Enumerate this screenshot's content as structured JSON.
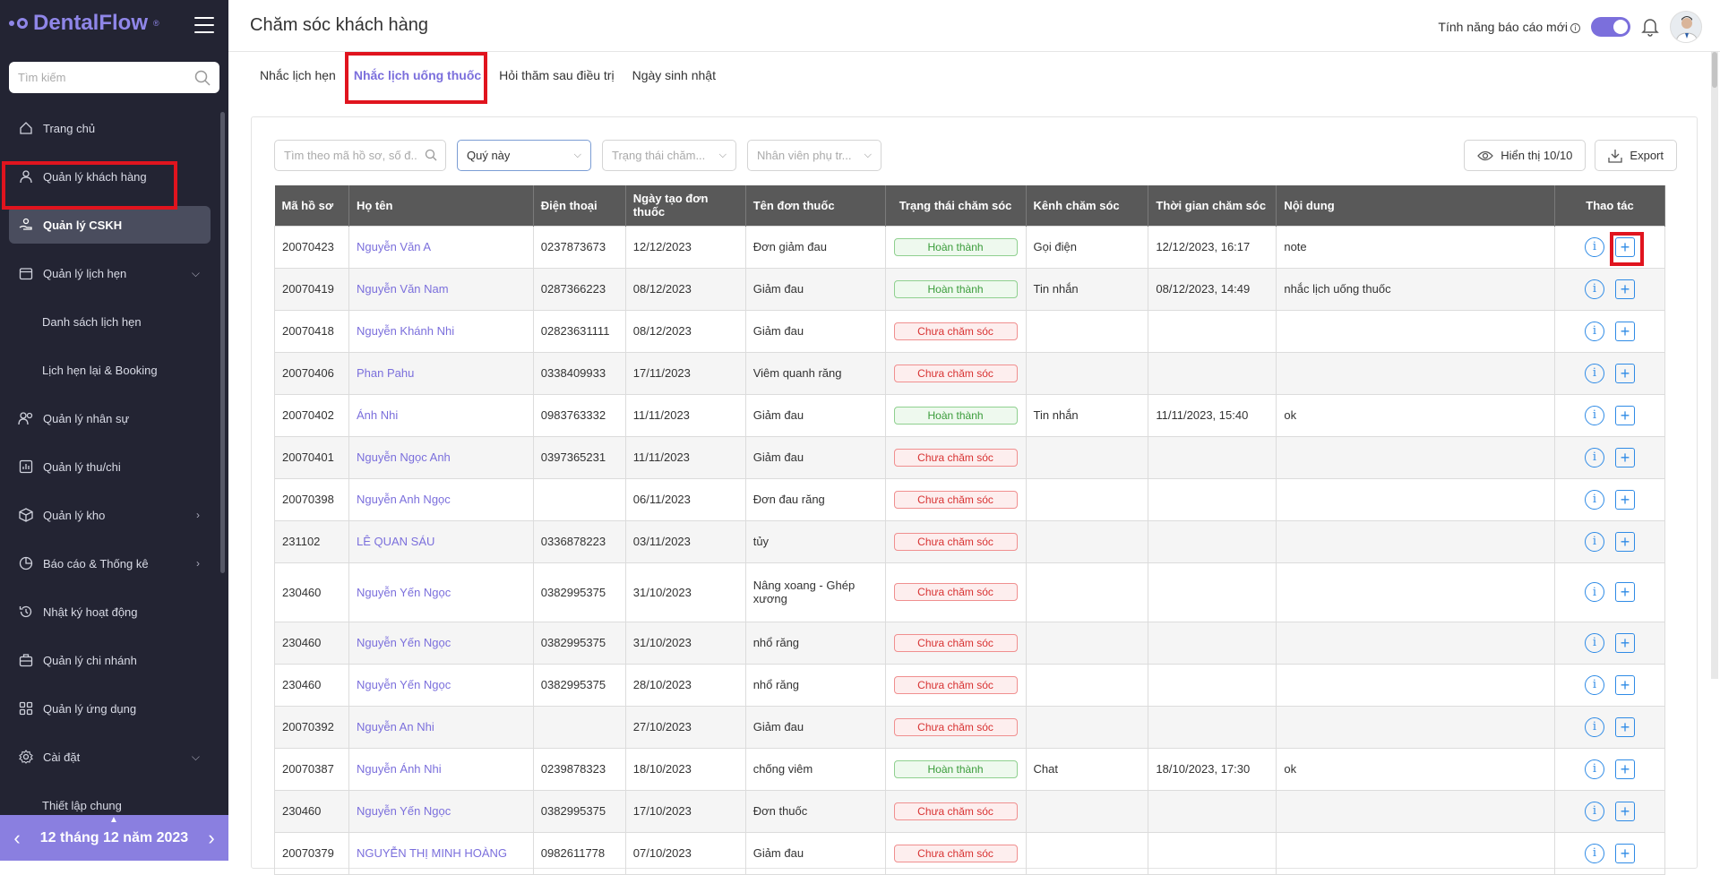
{
  "sidebar": {
    "logo": "DentalFlow",
    "search_placeholder": "Tìm kiếm",
    "items": [
      {
        "label": "Trang chủ",
        "icon": "home-icon"
      },
      {
        "label": "Quản lý khách hàng",
        "icon": "user-icon"
      },
      {
        "label": "Quản lý CSKH",
        "icon": "care-icon",
        "active": true
      },
      {
        "label": "Quản lý lịch hẹn",
        "icon": "calendar-icon",
        "chevron": "down"
      },
      {
        "label": "Danh sách lịch hẹn",
        "sub": true
      },
      {
        "label": "Lịch hẹn lại & Booking",
        "sub": true
      },
      {
        "label": "Quản lý nhân sự",
        "icon": "users-icon"
      },
      {
        "label": "Quản lý thu/chi",
        "icon": "chart-icon"
      },
      {
        "label": "Quản lý kho",
        "icon": "box-icon",
        "chevron": "right"
      },
      {
        "label": "Báo cáo & Thống kê",
        "icon": "pie-icon",
        "chevron": "right"
      },
      {
        "label": "Nhật ký hoạt động",
        "icon": "history-icon"
      },
      {
        "label": "Quản lý chi nhánh",
        "icon": "briefcase-icon"
      },
      {
        "label": "Quản lý ứng dụng",
        "icon": "apps-icon"
      },
      {
        "label": "Cài đặt",
        "icon": "settings-icon",
        "chevron": "down"
      },
      {
        "label": "Thiết lập chung",
        "sub": true
      }
    ],
    "date": "12 tháng 12 năm 2023"
  },
  "header": {
    "title": "Chăm sóc khách hàng",
    "feature_label": "Tính năng báo cáo mới"
  },
  "tabs": [
    {
      "label": "Nhắc lịch hẹn"
    },
    {
      "label": "Nhắc lịch uống thuốc",
      "active": true
    },
    {
      "label": "Hỏi thăm sau điều trị"
    },
    {
      "label": "Ngày sinh nhật"
    }
  ],
  "filters": {
    "search_placeholder": "Tìm theo mã hồ sơ, số đ...",
    "period": "Quý này",
    "status_placeholder": "Trạng thái chăm...",
    "staff_placeholder": "Nhân viên phụ tr..."
  },
  "actions": {
    "display": "Hiển thị 10/10",
    "export": "Export"
  },
  "table": {
    "headers": [
      "Mã hồ sơ",
      "Họ tên",
      "Điện thoại",
      "Ngày tạo đơn thuốc",
      "Tên đơn thuốc",
      "Trạng thái chăm sóc",
      "Kênh chăm sóc",
      "Thời gian chăm sóc",
      "Nội dung",
      "Thao tác"
    ],
    "rows": [
      {
        "id": "20070423",
        "name": "Nguyễn Văn A",
        "phone": "0237873673",
        "date": "12/12/2023",
        "rx": "Đơn giảm đau",
        "status": "Hoàn thành",
        "channel": "Gọi điện",
        "time": "12/12/2023, 16:17",
        "note": "note"
      },
      {
        "id": "20070419",
        "name": "Nguyễn Văn Nam",
        "phone": "0287366223",
        "date": "08/12/2023",
        "rx": "Giảm đau",
        "status": "Hoàn thành",
        "channel": "Tin nhắn",
        "time": "08/12/2023, 14:49",
        "note": "nhắc lịch uống thuốc"
      },
      {
        "id": "20070418",
        "name": "Nguyễn Khánh Nhi",
        "phone": "02823631111",
        "date": "08/12/2023",
        "rx": "Giảm đau",
        "status": "Chưa chăm sóc",
        "channel": "",
        "time": "",
        "note": ""
      },
      {
        "id": "20070406",
        "name": "Phan Pahu",
        "phone": "0338409933",
        "date": "17/11/2023",
        "rx": "Viêm quanh răng",
        "status": "Chưa chăm sóc",
        "channel": "",
        "time": "",
        "note": ""
      },
      {
        "id": "20070402",
        "name": "Ánh Nhi",
        "phone": "0983763332",
        "date": "11/11/2023",
        "rx": "Giảm đau",
        "status": "Hoàn thành",
        "channel": "Tin nhắn",
        "time": "11/11/2023, 15:40",
        "note": "ok"
      },
      {
        "id": "20070401",
        "name": "Nguyễn Ngọc Anh",
        "phone": "0397365231",
        "date": "11/11/2023",
        "rx": "Giảm đau",
        "status": "Chưa chăm sóc",
        "channel": "",
        "time": "",
        "note": ""
      },
      {
        "id": "20070398",
        "name": "Nguyễn Anh Ngọc",
        "phone": "",
        "date": "06/11/2023",
        "rx": "Đơn đau răng",
        "status": "Chưa chăm sóc",
        "channel": "",
        "time": "",
        "note": ""
      },
      {
        "id": "231102",
        "name": "LÊ QUAN SÁU",
        "phone": "0336878223",
        "date": "03/11/2023",
        "rx": "tủy",
        "status": "Chưa chăm sóc",
        "channel": "",
        "time": "",
        "note": ""
      },
      {
        "id": "230460",
        "name": "Nguyễn Yến Ngọc",
        "phone": "0382995375",
        "date": "31/10/2023",
        "rx": "Nâng xoang - Ghép xương",
        "status": "Chưa chăm sóc",
        "channel": "",
        "time": "",
        "note": "",
        "tall": true
      },
      {
        "id": "230460",
        "name": "Nguyễn Yến Ngọc",
        "phone": "0382995375",
        "date": "31/10/2023",
        "rx": "nhổ răng",
        "status": "Chưa chăm sóc",
        "channel": "",
        "time": "",
        "note": ""
      },
      {
        "id": "230460",
        "name": "Nguyễn Yến Ngọc",
        "phone": "0382995375",
        "date": "28/10/2023",
        "rx": "nhổ răng",
        "status": "Chưa chăm sóc",
        "channel": "",
        "time": "",
        "note": ""
      },
      {
        "id": "20070392",
        "name": "Nguyễn An Nhi",
        "phone": "",
        "date": "27/10/2023",
        "rx": "Giảm đau",
        "status": "Chưa chăm sóc",
        "channel": "",
        "time": "",
        "note": ""
      },
      {
        "id": "20070387",
        "name": "Nguyễn Ánh Nhi",
        "phone": "0239878323",
        "date": "18/10/2023",
        "rx": "chống viêm",
        "status": "Hoàn thành",
        "channel": "Chat",
        "time": "18/10/2023, 17:30",
        "note": "ok"
      },
      {
        "id": "230460",
        "name": "Nguyễn Yến Ngọc",
        "phone": "0382995375",
        "date": "17/10/2023",
        "rx": "Đơn thuốc",
        "status": "Chưa chăm sóc",
        "channel": "",
        "time": "",
        "note": ""
      },
      {
        "id": "20070379",
        "name": "NGUYỄN THỊ MINH HOÀNG",
        "phone": "0982611778",
        "date": "07/10/2023",
        "rx": "Giảm đau",
        "status": "Chưa chăm sóc",
        "channel": "",
        "time": "",
        "note": ""
      }
    ]
  },
  "colors": {
    "accent": "#7b6fdc",
    "sidebar": "#232433",
    "done": "#3a9c3a",
    "todo": "#d83232",
    "action": "#2f8be6",
    "highlight": "#e0141e"
  }
}
